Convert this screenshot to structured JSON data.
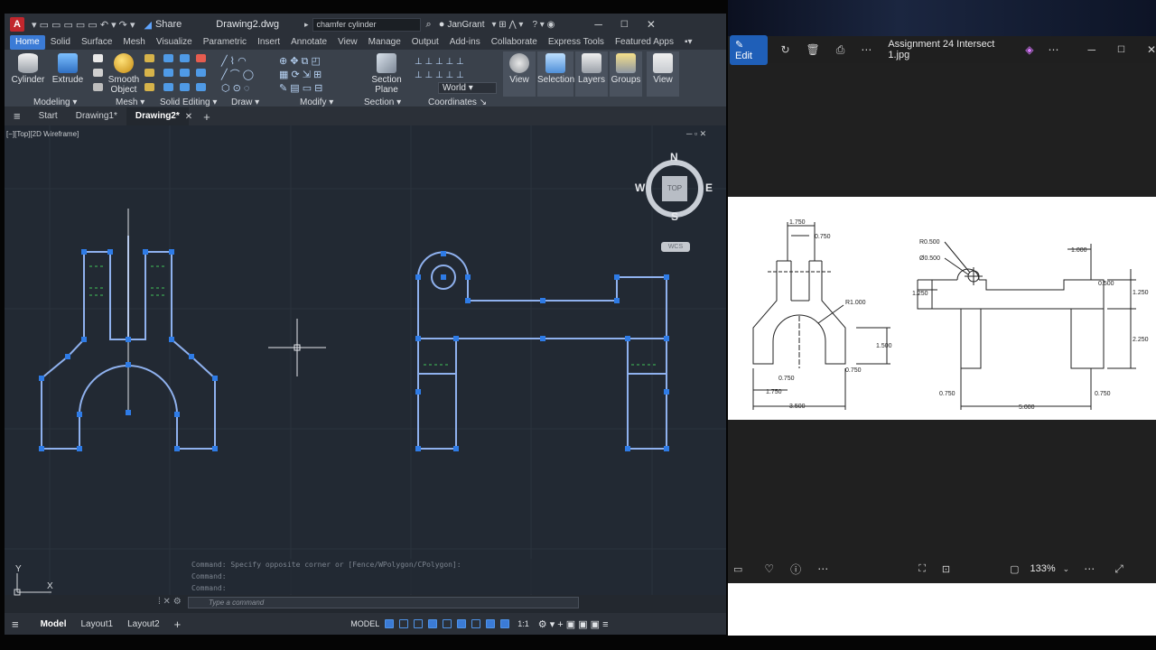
{
  "acad": {
    "title": "Drawing2.dwg",
    "share": "Share",
    "search": "chamfer cylinder",
    "user": "JanGrant",
    "ribbon_tabs": [
      "Home",
      "Solid",
      "Surface",
      "Mesh",
      "Visualize",
      "Parametric",
      "Insert",
      "Annotate",
      "View",
      "Manage",
      "Output",
      "Add-ins",
      "Collaborate",
      "Express Tools",
      "Featured Apps"
    ],
    "buttons": {
      "cylinder": "Cylinder",
      "extrude": "Extrude",
      "smooth": "Smooth Object",
      "section": "Section Plane",
      "view": "View",
      "selection": "Selection",
      "layers": "Layers",
      "groups": "Groups",
      "view2": "View",
      "world": "World"
    },
    "panels": [
      "Modeling",
      "Mesh",
      "Solid Editing",
      "Draw",
      "Modify",
      "Section",
      "Coordinates"
    ],
    "file_tabs": [
      "Start",
      "Drawing1*",
      "Drawing2*"
    ],
    "viewport_label": "[−][Top][2D Wireframe]",
    "viewcube": {
      "n": "N",
      "s": "S",
      "e": "E",
      "w": "W",
      "face": "TOP",
      "wcs": "WCS"
    },
    "command_history": [
      "Command: Specify opposite corner or [Fence/WPolygon/CPolygon]:",
      "Command:",
      "Command:"
    ],
    "command_placeholder": "Type a command",
    "layout_tabs": [
      "Model",
      "Layout1",
      "Layout2"
    ],
    "model_label": "MODEL",
    "scale": "1:1",
    "ucs": {
      "x": "X",
      "y": "Y"
    }
  },
  "photos": {
    "edit": "Edit",
    "title": "Assignment 24 Intersect 1.jpg",
    "zoom": "133%"
  },
  "drawing": {
    "dims": [
      "1.750",
      "0.750",
      "R1.000",
      "1.500",
      "0.750",
      "0.750",
      "1.750",
      "3.500",
      "R0.500",
      "Ø0.500",
      "1.000",
      "0.500",
      "1.250",
      "1.250",
      "2.250",
      "0.750",
      "5.000",
      "0.750"
    ]
  },
  "colors": {
    "accent": "#3b7bd6",
    "geometry": "#8fb1ee",
    "grip": "#2e7be6",
    "dash": "#43c25a"
  }
}
